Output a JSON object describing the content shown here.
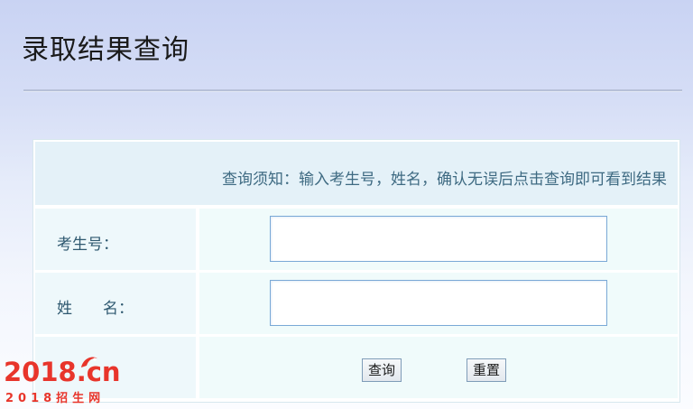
{
  "page": {
    "title": "录取结果查询"
  },
  "notice": {
    "text": "查询须知：输入考生号，姓名，确认无误后点击查询即可看到结果"
  },
  "form": {
    "exam_number": {
      "label": "考生号：",
      "value": ""
    },
    "name": {
      "label": "姓　　名：",
      "value": ""
    },
    "query_button": "查询",
    "reset_button": "重置"
  },
  "logo": {
    "main": "2018.cn",
    "sub": "2018招生网",
    "color": "#e8352b"
  }
}
